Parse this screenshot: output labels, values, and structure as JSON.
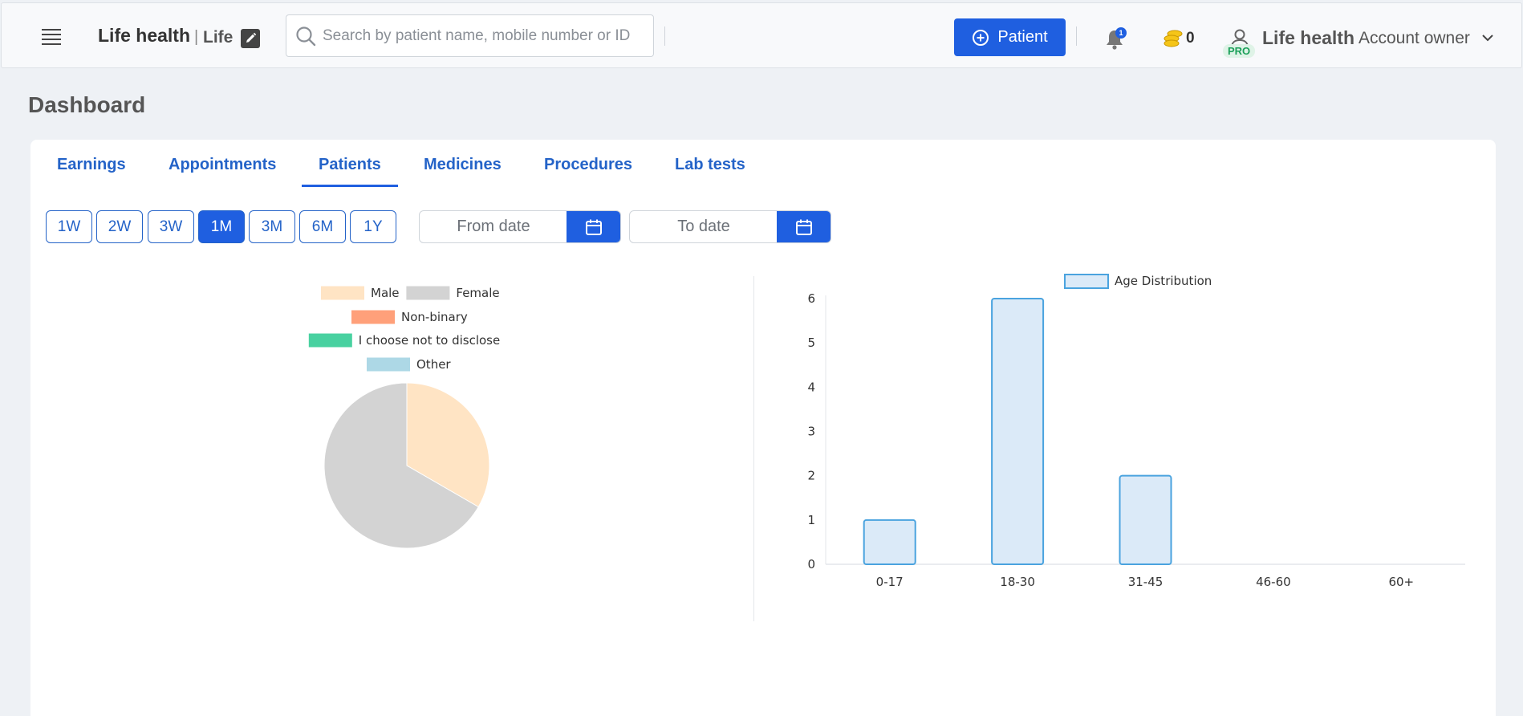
{
  "header": {
    "brand": "Life health",
    "brand_separator": "|",
    "brand_sub": "Life",
    "search_placeholder": "Search by patient name, mobile number or ID",
    "add_patient_label": "Patient",
    "notification_count": "1",
    "coins_count": "0",
    "pro_label": "PRO",
    "user_name": "Life health",
    "user_role": "Account owner"
  },
  "page": {
    "title": "Dashboard"
  },
  "tabs": [
    {
      "label": "Earnings"
    },
    {
      "label": "Appointments"
    },
    {
      "label": "Patients",
      "active": true
    },
    {
      "label": "Medicines"
    },
    {
      "label": "Procedures"
    },
    {
      "label": "Lab tests"
    }
  ],
  "ranges": [
    {
      "label": "1W"
    },
    {
      "label": "2W"
    },
    {
      "label": "3W"
    },
    {
      "label": "1M",
      "active": true
    },
    {
      "label": "3M"
    },
    {
      "label": "6M"
    },
    {
      "label": "1Y"
    }
  ],
  "filters": {
    "from_placeholder": "From date",
    "to_placeholder": "To date"
  },
  "colors": {
    "accent": "#1f5fe0",
    "tab_text": "#2463c8"
  },
  "chart_data": [
    {
      "type": "pie",
      "categories": [
        "Male",
        "Female",
        "Non-binary",
        "I choose not to disclose",
        "Other"
      ],
      "values": [
        1,
        2,
        0,
        0,
        0
      ],
      "colors": [
        "#ffe4c4",
        "#d3d3d3",
        "#ffa07a",
        "#48d1a0",
        "#add8e6"
      ],
      "legend": "top"
    },
    {
      "type": "bar",
      "series": [
        {
          "name": "Age Distribution",
          "values": [
            1,
            6,
            2,
            0,
            0
          ]
        }
      ],
      "categories": [
        "0-17",
        "18-30",
        "31-45",
        "46-60",
        "60+"
      ],
      "ylim": [
        0,
        6
      ],
      "yticks": [
        0,
        1,
        2,
        3,
        4,
        5,
        6
      ],
      "fill": "#dbeaf8",
      "stroke": "#4aa3df",
      "legend": "top"
    }
  ]
}
